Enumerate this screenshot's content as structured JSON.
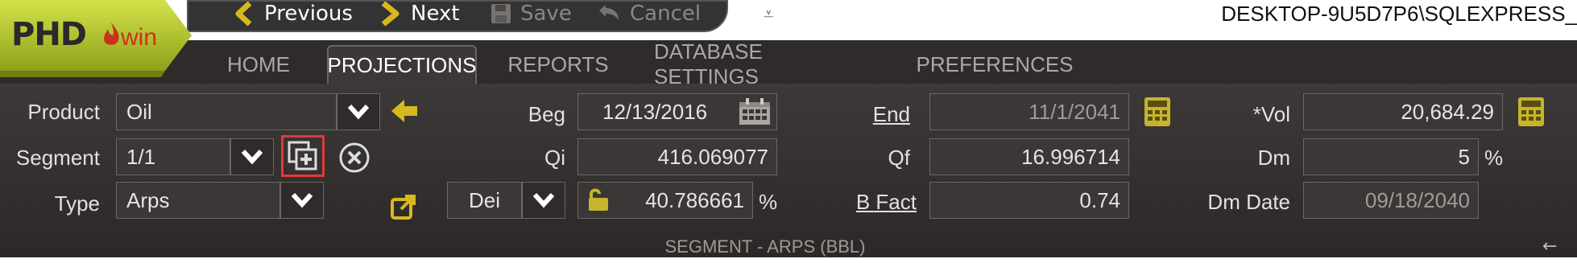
{
  "app": {
    "logo_text": "PHD",
    "logo_suffix": "win",
    "server": "DESKTOP-9U5D7P6\\SQLEXPRESS_"
  },
  "toolbar": {
    "previous": "Previous",
    "next": "Next",
    "save": "Save",
    "cancel": "Cancel",
    "qat_glyph": "⩡"
  },
  "tabs": [
    {
      "label": "HOME"
    },
    {
      "label": "PROJECTIONS"
    },
    {
      "label": "REPORTS"
    },
    {
      "label": "DATABASE SETTINGS"
    },
    {
      "label": "PREFERENCES"
    }
  ],
  "active_tab": "PROJECTIONS",
  "form": {
    "product_label": "Product",
    "product_value": "Oil",
    "segment_label": "Segment",
    "segment_value": "1/1",
    "type_label": "Type",
    "type_value": "Arps",
    "beg_label": "Beg",
    "beg_value": "12/13/2016",
    "qi_label": "Qi",
    "qi_value": "416.069077",
    "dei_option": "Dei",
    "dei_value": "40.786661",
    "dei_unit": "%",
    "end_label": "End",
    "end_value": "11/1/2041",
    "qf_label": "Qf",
    "qf_value": "16.996714",
    "bfact_label": "B Fact",
    "bfact_value": "0.74",
    "vol_label": "*Vol",
    "vol_value": "20,684.29",
    "dm_label": "Dm",
    "dm_value": "5",
    "dm_unit": "%",
    "dmdate_label": "Dm Date",
    "dmdate_value": "09/18/2040"
  },
  "section_caption": "SEGMENT - ARPS (BBL)",
  "pin_glyph": "←",
  "colors": {
    "accent_lime": "#b5cc2b",
    "icon_gold": "#c7b42c",
    "highlight_red": "#e03a3a",
    "panel_bg": "#2f2b2a"
  }
}
